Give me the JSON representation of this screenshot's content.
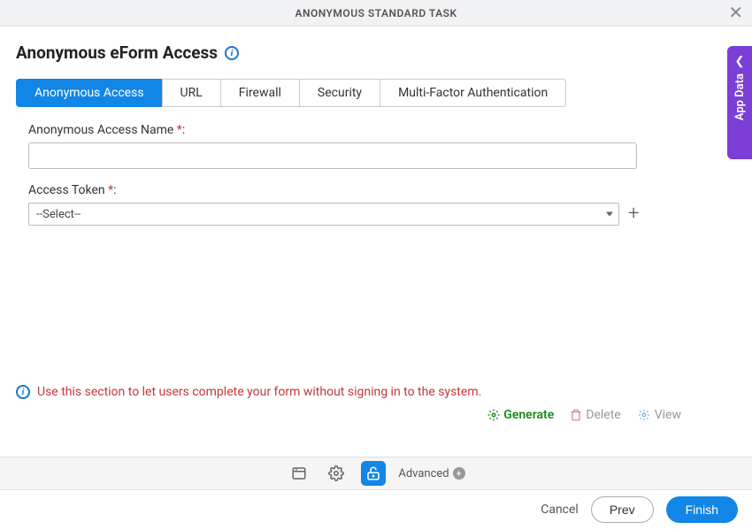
{
  "header": {
    "title": "ANONYMOUS STANDARD TASK"
  },
  "page": {
    "title": "Anonymous eForm Access"
  },
  "tabs": [
    {
      "label": "Anonymous Access",
      "active": true
    },
    {
      "label": "URL",
      "active": false
    },
    {
      "label": "Firewall",
      "active": false
    },
    {
      "label": "Security",
      "active": false
    },
    {
      "label": "Multi-Factor Authentication",
      "active": false
    }
  ],
  "form": {
    "name_label": "Anonymous Access Name ",
    "name_value": "",
    "token_label": "Access Token ",
    "token_value": "--Select--"
  },
  "info_message": "Use this section to let users complete your form without signing in to the system.",
  "actions": {
    "generate": "Generate",
    "delete": "Delete",
    "view": "View"
  },
  "toolbar": {
    "advanced": "Advanced"
  },
  "footer": {
    "cancel": "Cancel",
    "prev": "Prev",
    "finish": "Finish"
  },
  "side_tab": {
    "label": "App Data"
  }
}
